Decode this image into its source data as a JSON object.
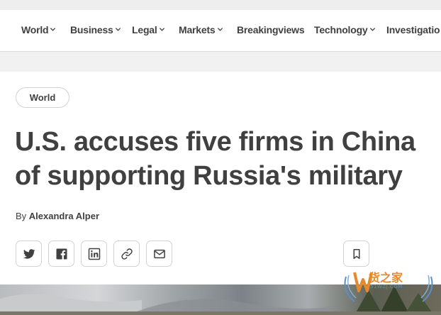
{
  "nav": {
    "items": [
      {
        "label": "World",
        "chevron": true
      },
      {
        "label": "Business",
        "chevron": true
      },
      {
        "label": "Legal",
        "chevron": true
      },
      {
        "label": "Markets",
        "chevron": true
      },
      {
        "label": "Breakingviews",
        "chevron": false
      },
      {
        "label": "Technology",
        "chevron": true
      },
      {
        "label": "Investigatio",
        "chevron": false
      }
    ]
  },
  "article": {
    "section_pill": "World",
    "headline_line1": "U.S. accuses five firms in China",
    "headline_line2": "of supporting Russia's military",
    "byline_prefix": "By",
    "author": "Alexandra Alper"
  },
  "share": {
    "icons": [
      "twitter-icon",
      "facebook-icon",
      "linkedin-icon",
      "link-icon",
      "email-icon"
    ],
    "bookmark_icon": "bookmark-icon"
  },
  "watermark": {
    "brand": "货之家",
    "subtitle": "51WZJ.COM"
  },
  "colors": {
    "text": "#404040",
    "border": "#d2d2d2",
    "watermark_orange": "#e58a2a",
    "watermark_blue": "#5a8fc7"
  }
}
